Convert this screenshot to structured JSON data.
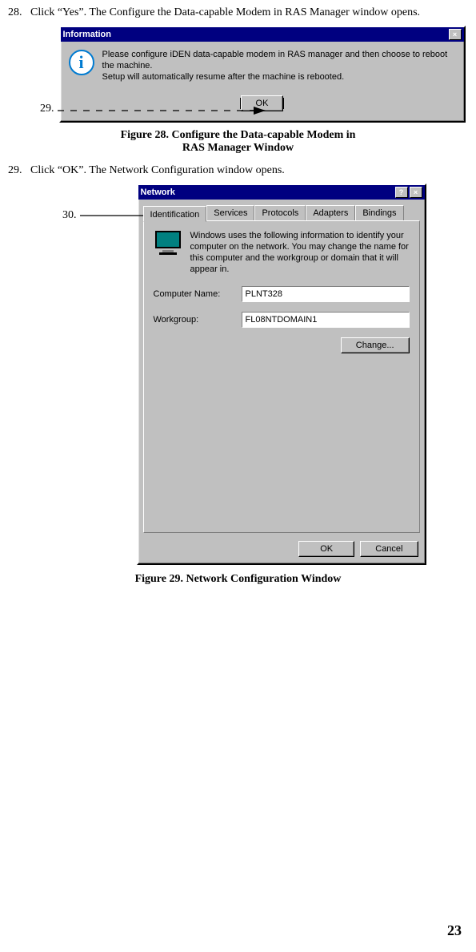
{
  "step28": {
    "num": "28.",
    "text": "Click “Yes”. The Configure the Data-capable Modem in RAS Manager window opens."
  },
  "callout29": "29.",
  "figure28_caption_line1": "Figure 28. Configure the Data-capable Modem in",
  "figure28_caption_line2": "RAS Manager Window",
  "step29": {
    "num": "29.",
    "text": "Click “OK”. The Network Configuration window opens."
  },
  "callout30": "30.",
  "figure29_caption": "Figure 29. Network Configuration Window",
  "page_number": "23",
  "info_window": {
    "title": "Information",
    "close": "×",
    "text_line1": "Please configure iDEN data-capable modem in RAS manager and then choose to reboot the machine.",
    "text_line2": "Setup will automatically resume after the machine is rebooted.",
    "ok": "OK"
  },
  "network_window": {
    "title": "Network",
    "help": "?",
    "close": "×",
    "tabs": {
      "identification": "Identification",
      "services": "Services",
      "protocols": "Protocols",
      "adapters": "Adapters",
      "bindings": "Bindings"
    },
    "description": "Windows uses the following information to identify your computer on the network.  You may change the name for this computer and the workgroup or domain that it will appear in.",
    "computer_name_label": "Computer Name:",
    "computer_name_value": "PLNT328",
    "workgroup_label": "Workgroup:",
    "workgroup_value": "FL08NTDOMAIN1",
    "change": "Change...",
    "ok": "OK",
    "cancel": "Cancel"
  }
}
